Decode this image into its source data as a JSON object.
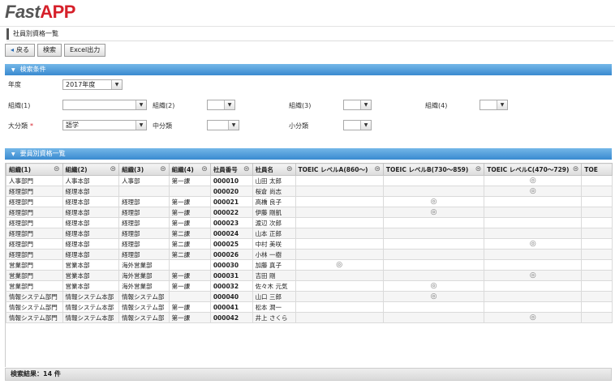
{
  "app": {
    "logo_text_a": "Fast",
    "logo_text_b": "APP"
  },
  "page_title": "社員別資格一覧",
  "toolbar": {
    "back_label": "戻る",
    "search_label": "検索",
    "excel_label": "Excel出力"
  },
  "search_panel": {
    "title": "検索条件",
    "year_label": "年度",
    "year_value": "2017年度",
    "org1_label": "組織(1)",
    "org2_label": "組織(2)",
    "org3_label": "組織(3)",
    "org4_label": "組織(4)",
    "major_label": "大分類",
    "major_value": "語学",
    "required_mark": "*",
    "middle_label": "中分類",
    "minor_label": "小分類"
  },
  "grid": {
    "title": "要員別資格一覧",
    "columns": [
      "組織(1)",
      "組織(2)",
      "組織(3)",
      "組織(4)",
      "社員番号",
      "社員名",
      "TOEIC レベルA(860〜)",
      "TOEIC レベルB(730〜859)",
      "TOEIC レベルC(470〜729)",
      "TOE"
    ],
    "mark": "◎",
    "rows": [
      [
        "人事部門",
        "人事本部",
        "人事部",
        "第一課",
        "000010",
        "山田 太郎",
        "",
        "",
        "◎"
      ],
      [
        "経理部門",
        "経理本部",
        "",
        "",
        "000020",
        "桜倉 尚志",
        "",
        "",
        "◎"
      ],
      [
        "経理部門",
        "経理本部",
        "経理部",
        "第一課",
        "000021",
        "高橋 良子",
        "",
        "◎",
        ""
      ],
      [
        "経理部門",
        "経理本部",
        "経理部",
        "第一課",
        "000022",
        "伊藤 剛凱",
        "",
        "◎",
        ""
      ],
      [
        "経理部門",
        "経理本部",
        "経理部",
        "第一課",
        "000023",
        "渡辺 次郎",
        "",
        "",
        ""
      ],
      [
        "経理部門",
        "経理本部",
        "経理部",
        "第二課",
        "000024",
        "山本 正郎",
        "",
        "",
        ""
      ],
      [
        "経理部門",
        "経理本部",
        "経理部",
        "第二課",
        "000025",
        "中村 美咲",
        "",
        "",
        "◎"
      ],
      [
        "経理部門",
        "経理本部",
        "経理部",
        "第二課",
        "000026",
        "小林 一樹",
        "",
        "",
        ""
      ],
      [
        "営業部門",
        "営業本部",
        "海外営業部",
        "",
        "000030",
        "加藤 真子",
        "◎",
        "",
        ""
      ],
      [
        "営業部門",
        "営業本部",
        "海外営業部",
        "第一課",
        "000031",
        "吉田 剛",
        "",
        "",
        "◎"
      ],
      [
        "営業部門",
        "営業本部",
        "海外営業部",
        "第一課",
        "000032",
        "佐々木 元気",
        "",
        "◎",
        ""
      ],
      [
        "情報システム部門",
        "情報システム本部",
        "情報システム部",
        "",
        "000040",
        "山口 三郎",
        "",
        "◎",
        ""
      ],
      [
        "情報システム部門",
        "情報システム本部",
        "情報システム部",
        "第一課",
        "000041",
        "松本 潤一",
        "",
        "",
        ""
      ],
      [
        "情報システム部門",
        "情報システム本部",
        "情報システム部",
        "第一課",
        "000042",
        "井上 さくら",
        "",
        "",
        "◎"
      ]
    ]
  },
  "footer": {
    "result_text": "検索結果：14 件"
  }
}
